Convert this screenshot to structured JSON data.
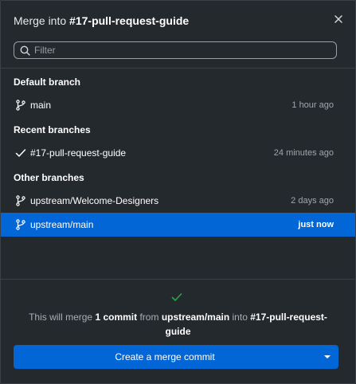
{
  "dialog": {
    "title_prefix": "Merge into",
    "title_branch": "#17-pull-request-guide"
  },
  "filter": {
    "placeholder": "Filter",
    "value": ""
  },
  "sections": {
    "default_title": "Default branch",
    "recent_title": "Recent branches",
    "other_title": "Other branches"
  },
  "branches": {
    "default": [
      {
        "name": "main",
        "time": "1 hour ago",
        "icon": "git-branch-icon"
      }
    ],
    "recent": [
      {
        "name": "#17-pull-request-guide",
        "time": "24 minutes ago",
        "icon": "check-icon"
      }
    ],
    "other": [
      {
        "name": "upstream/Welcome-Designers",
        "time": "2 days ago",
        "icon": "git-branch-icon"
      },
      {
        "name": "upstream/main",
        "time": "just now",
        "icon": "git-branch-icon",
        "selected": true
      }
    ]
  },
  "footer": {
    "status_icon": "check-icon",
    "summary_prefix": "This will merge",
    "summary_count": "1 commit",
    "summary_from": "from",
    "summary_source": "upstream/main",
    "summary_into": "into",
    "summary_target": "#17-pull-request-guide",
    "button_label": "Create a merge commit"
  },
  "colors": {
    "background": "#24292e",
    "accent": "#0366d6",
    "success": "#28a745"
  }
}
